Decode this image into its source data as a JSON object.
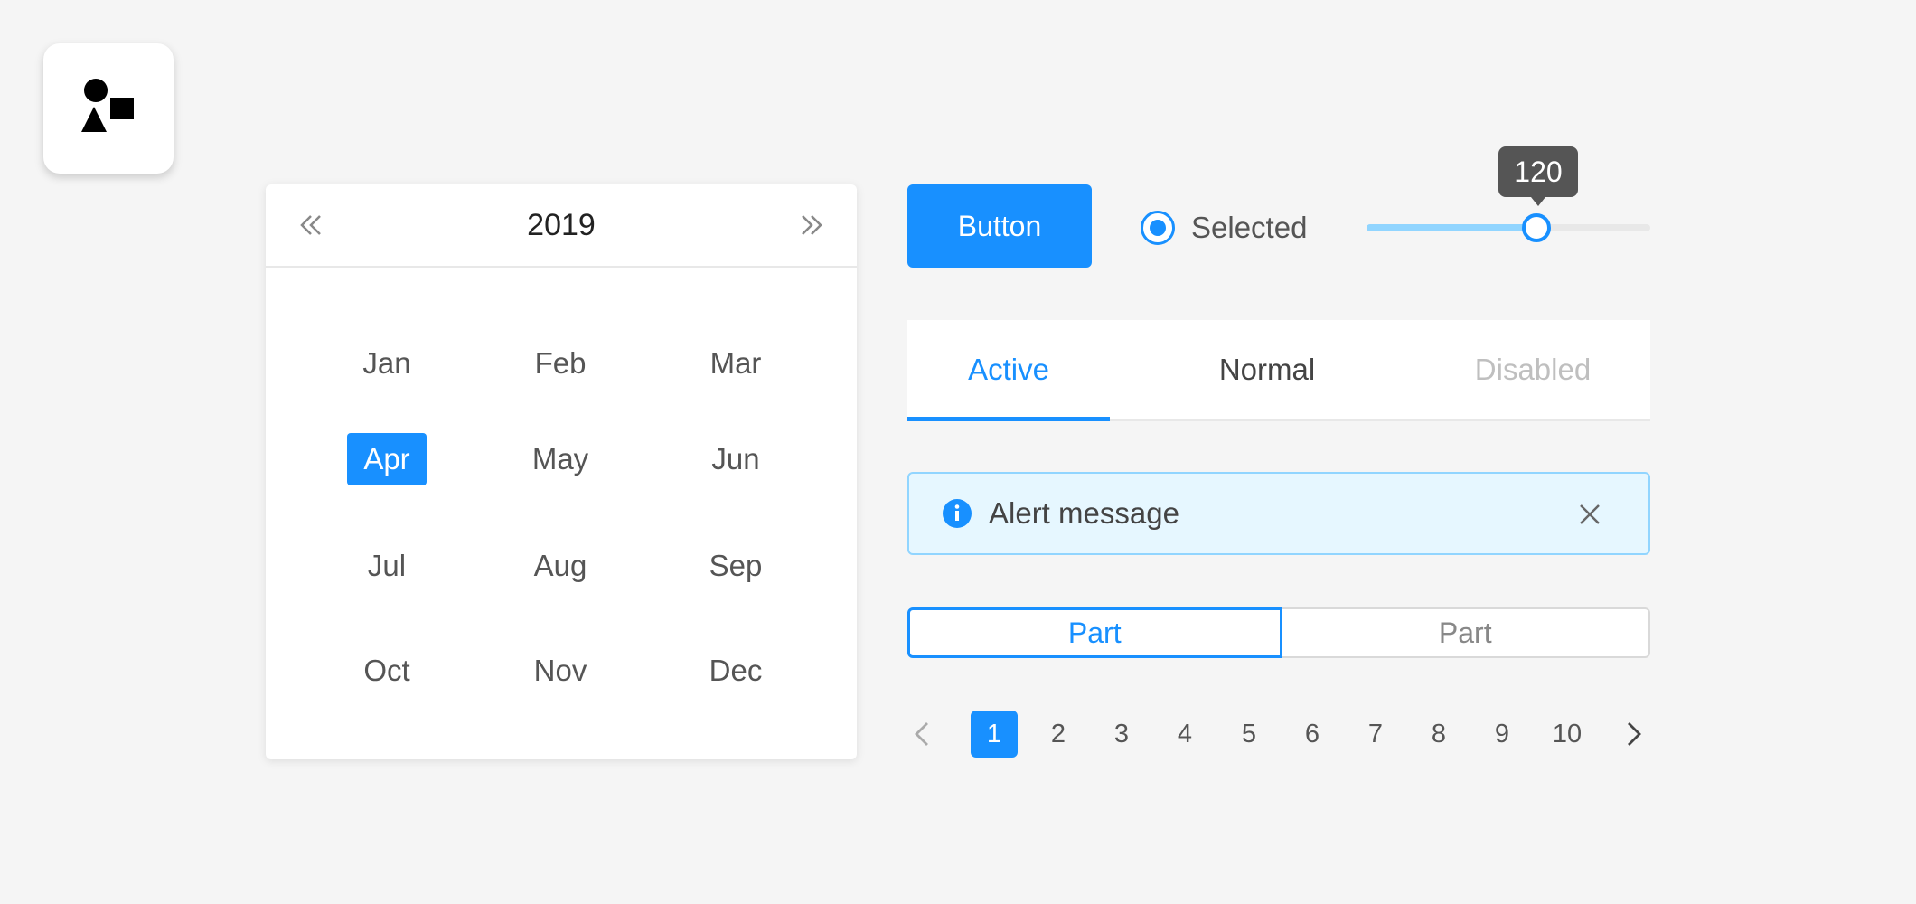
{
  "logo": {
    "icon": "shapes-icon"
  },
  "calendar": {
    "year": "2019",
    "prev_icon": "double-chevron-left-icon",
    "next_icon": "double-chevron-right-icon",
    "months": [
      "Jan",
      "Feb",
      "Mar",
      "Apr",
      "May",
      "Jun",
      "Jul",
      "Aug",
      "Sep",
      "Oct",
      "Nov",
      "Dec"
    ],
    "selected_month": "Apr"
  },
  "button": {
    "label": "Button"
  },
  "radio": {
    "label": "Selected",
    "checked": true
  },
  "slider": {
    "value": "120",
    "fraction": 0.6
  },
  "tabs": [
    {
      "label": "Active",
      "state": "active"
    },
    {
      "label": "Normal",
      "state": "normal"
    },
    {
      "label": "Disabled",
      "state": "disabled"
    }
  ],
  "alert": {
    "message": "Alert message",
    "icon": "info-icon",
    "close_icon": "close-icon"
  },
  "segmented": [
    {
      "label": "Part",
      "active": true
    },
    {
      "label": "Part",
      "active": false
    }
  ],
  "pagination": {
    "pages": [
      "1",
      "2",
      "3",
      "4",
      "5",
      "6",
      "7",
      "8",
      "9",
      "10"
    ],
    "current": "1",
    "prev_icon": "chevron-left-icon",
    "next_icon": "chevron-right-icon"
  },
  "colors": {
    "primary": "#1890ff",
    "alert_bg": "#e6f7ff",
    "alert_border": "#91d5ff",
    "slider_track": "#91d5ff",
    "background": "#f5f5f5"
  }
}
